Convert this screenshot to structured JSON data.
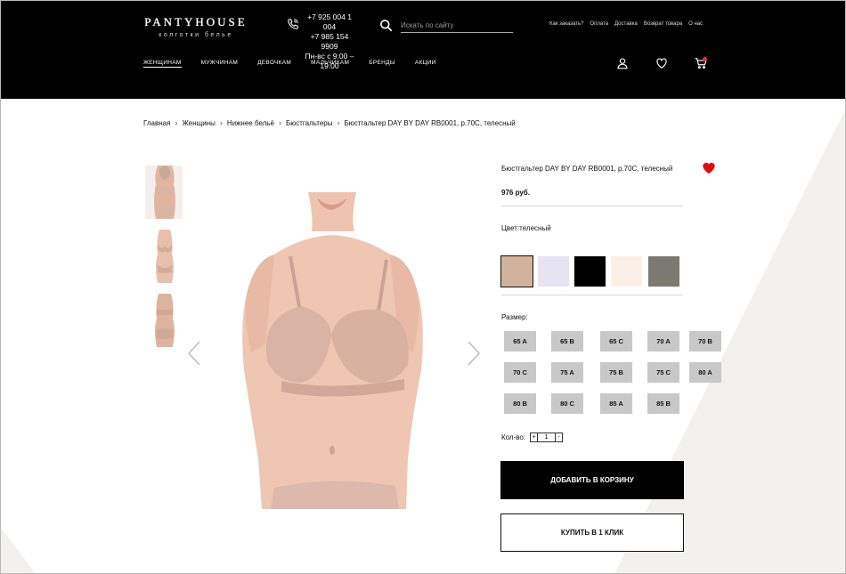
{
  "header": {
    "logo_title": "PANTYHOUSE",
    "logo_subtitle": "колготки белье",
    "phones": [
      "+7 925 004 1 004",
      "+7 985 154 9909",
      "Пн-вс с 9:00 – 19:00"
    ],
    "search_placeholder": "Искать по сайту",
    "top_links": [
      "Как заказать?",
      "Оплата",
      "Доставка",
      "Возврат товара",
      "О нас"
    ],
    "categories": [
      "ЖЕНЩИНАМ",
      "МУЖЧИНАМ",
      "ДЕВОЧКАМ",
      "МАЛЬЧИКАМ",
      "БРЕНДЫ",
      "АКЦИИ"
    ],
    "active_category": "ЖЕНЩИНАМ",
    "icons": [
      "user-icon",
      "heart-icon",
      "cart-icon"
    ]
  },
  "breadcrumb": [
    "Главная",
    "Женщины",
    "Нижнее бельё",
    "Бюстгальтеры",
    "Бюстгальтер DAY BY DAY RB0001, р.70С, телесный"
  ],
  "product": {
    "title": "Бюстгальтер DAY BY DAY RB0001, р.70С, телесный",
    "price": "976 руб.",
    "color_label": "Цвет:телесный",
    "colors": [
      "#d2b29a",
      "#e6e4f2",
      "#000000",
      "#fbf0e6",
      "#7a7a70"
    ],
    "selected_color": 0,
    "size_label": "Размер:",
    "sizes": [
      "65 A",
      "65 B",
      "65 C",
      "70 A",
      "70 B",
      "70 C",
      "75 A",
      "75 B",
      "75 C",
      "80 A",
      "80 B",
      "80 C",
      "85 A",
      "85 B"
    ],
    "qty_label": "Кол-во:",
    "qty_minus": "-",
    "qty_value": "1",
    "qty_plus": "+",
    "add_to_cart": "ДОБАВИТЬ В КОРЗИНУ",
    "buy_one_click": "КУПИТЬ В 1 КЛИК"
  }
}
